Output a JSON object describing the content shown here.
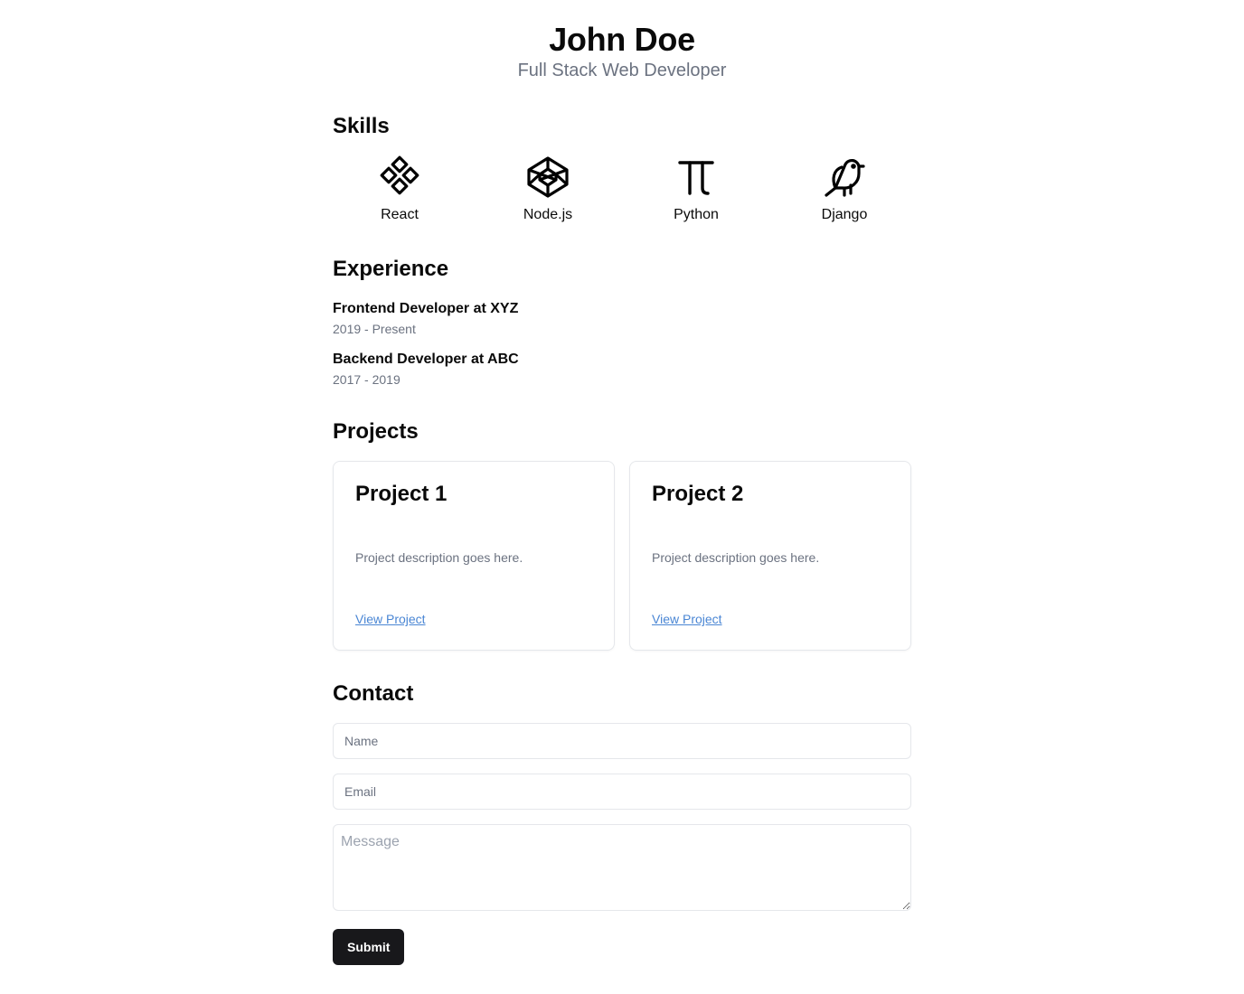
{
  "hero": {
    "name": "John Doe",
    "subtitle": "Full Stack Web Developer"
  },
  "skills": {
    "title": "Skills",
    "items": [
      {
        "label": "React",
        "icon": "diamonds-icon"
      },
      {
        "label": "Node.js",
        "icon": "codepen-icon"
      },
      {
        "label": "Python",
        "icon": "pi-icon"
      },
      {
        "label": "Django",
        "icon": "bird-icon"
      }
    ]
  },
  "experience": {
    "title": "Experience",
    "items": [
      {
        "role": "Frontend Developer at XYZ",
        "dates": "2019 - Present"
      },
      {
        "role": "Backend Developer at ABC",
        "dates": "2017 - 2019"
      }
    ]
  },
  "projects": {
    "title": "Projects",
    "items": [
      {
        "title": "Project 1",
        "description": "Project description goes here.",
        "link_label": "View Project"
      },
      {
        "title": "Project 2",
        "description": "Project description goes here.",
        "link_label": "View Project"
      }
    ]
  },
  "contact": {
    "title": "Contact",
    "name_placeholder": "Name",
    "email_placeholder": "Email",
    "message_placeholder": "Message",
    "submit_label": "Submit"
  },
  "colors": {
    "muted_text": "#6b7280",
    "link": "#4a86d4",
    "button_bg": "#18181b",
    "border": "#e5e7eb"
  }
}
